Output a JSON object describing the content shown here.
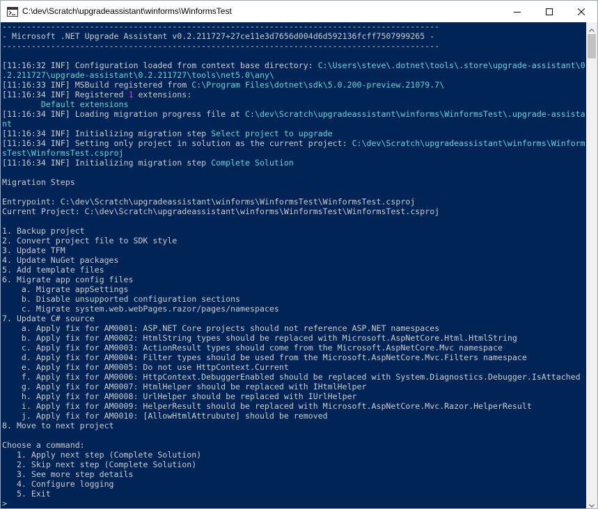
{
  "window": {
    "title": "C:\\dev\\Scratch\\upgradeassistant\\winforms\\WinformsTest",
    "controls": {
      "minimize_icon": "minimize-icon",
      "maximize_icon": "maximize-icon",
      "close_icon": "close-icon"
    }
  },
  "colors": {
    "background": "#012456",
    "text": "#cccccc",
    "highlight": "#61d6d6",
    "count": "#e03ae0"
  },
  "console": {
    "lines": [
      [
        {
          "t": "------------------------------------------------------------------------------------------",
          "c": "gray"
        }
      ],
      [
        {
          "t": "- Microsoft .NET Upgrade Assistant v0.2.211727+27ce11e3d7656d004d6d592136fcff7507999265 -",
          "c": "white"
        }
      ],
      [
        {
          "t": "------------------------------------------------------------------------------------------",
          "c": "gray"
        }
      ],
      [
        {
          "t": "",
          "c": "white"
        }
      ],
      [
        {
          "t": "[11:16:32 INF] Configuration loaded from context base directory: ",
          "c": "white"
        },
        {
          "t": "C:\\Users\\steve\\.dotnet\\tools\\.store\\upgrade-assistant\\0",
          "c": "cyan"
        }
      ],
      [
        {
          "t": ".2.211727\\upgrade-assistant\\0.2.211727\\tools\\net5.0\\any\\",
          "c": "cyan"
        }
      ],
      [
        {
          "t": "[11:16:33 INF] MSBuild registered from ",
          "c": "white"
        },
        {
          "t": "C:\\Program Files\\dotnet\\sdk\\5.0.200-preview.21079.7\\",
          "c": "cyan"
        }
      ],
      [
        {
          "t": "[11:16:34 INF] Registered ",
          "c": "white"
        },
        {
          "t": "1",
          "c": "magenta"
        },
        {
          "t": " extensions:",
          "c": "white"
        }
      ],
      [
        {
          "t": "        Default extensions",
          "c": "cyan"
        }
      ],
      [
        {
          "t": "[11:16:34 INF] Loading migration progress file at ",
          "c": "white"
        },
        {
          "t": "C:\\dev\\Scratch\\upgradeassistant\\winforms\\WinformsTest\\.upgrade-assista",
          "c": "cyan"
        }
      ],
      [
        {
          "t": "nt",
          "c": "cyan"
        }
      ],
      [
        {
          "t": "[11:16:34 INF] Initializing migration step ",
          "c": "white"
        },
        {
          "t": "Select project to upgrade",
          "c": "cyan"
        }
      ],
      [
        {
          "t": "[11:16:34 INF] Setting only project in solution as the current project: ",
          "c": "white"
        },
        {
          "t": "C:\\dev\\Scratch\\upgradeassistant\\winforms\\Winform",
          "c": "cyan"
        }
      ],
      [
        {
          "t": "sTest\\WinformsTest.csproj",
          "c": "cyan"
        }
      ],
      [
        {
          "t": "[11:16:34 INF] Initializing migration step ",
          "c": "white"
        },
        {
          "t": "Complete Solution",
          "c": "cyan"
        }
      ],
      [
        {
          "t": "",
          "c": "white"
        }
      ],
      [
        {
          "t": "Migration Steps",
          "c": "white"
        }
      ],
      [
        {
          "t": "",
          "c": "white"
        }
      ],
      [
        {
          "t": "Entrypoint: C:\\dev\\Scratch\\upgradeassistant\\winforms\\WinformsTest\\WinformsTest.csproj",
          "c": "white"
        }
      ],
      [
        {
          "t": "Current Project: C:\\dev\\Scratch\\upgradeassistant\\winforms\\WinformsTest\\WinformsTest.csproj",
          "c": "white"
        }
      ],
      [
        {
          "t": "",
          "c": "white"
        }
      ],
      [
        {
          "t": "1. Backup project",
          "c": "white"
        }
      ],
      [
        {
          "t": "2. Convert project file to SDK style",
          "c": "white"
        }
      ],
      [
        {
          "t": "3. Update TFM",
          "c": "white"
        }
      ],
      [
        {
          "t": "4. Update NuGet packages",
          "c": "white"
        }
      ],
      [
        {
          "t": "5. Add template files",
          "c": "white"
        }
      ],
      [
        {
          "t": "6. Migrate app config files",
          "c": "white"
        }
      ],
      [
        {
          "t": "    a. Migrate appSettings",
          "c": "white"
        }
      ],
      [
        {
          "t": "    b. Disable unsupported configuration sections",
          "c": "white"
        }
      ],
      [
        {
          "t": "    c. Migrate system.web.webPages.razor/pages/namespaces",
          "c": "white"
        }
      ],
      [
        {
          "t": "7. Update C# source",
          "c": "white"
        }
      ],
      [
        {
          "t": "    a. Apply fix for AM0001: ASP.NET Core projects should not reference ASP.NET namespaces",
          "c": "white"
        }
      ],
      [
        {
          "t": "    b. Apply fix for AM0002: HtmlString types should be replaced with Microsoft.AspNetCore.Html.HtmlString",
          "c": "white"
        }
      ],
      [
        {
          "t": "    c. Apply fix for AM0003: ActionResult types should come from the Microsoft.AspNetCore.Mvc namespace",
          "c": "white"
        }
      ],
      [
        {
          "t": "    d. Apply fix for AM0004: Filter types should be used from the Microsoft.AspNetCore.Mvc.Filters namespace",
          "c": "white"
        }
      ],
      [
        {
          "t": "    e. Apply fix for AM0005: Do not use HttpContext.Current",
          "c": "white"
        }
      ],
      [
        {
          "t": "    f. Apply fix for AM0006: HttpContext.DebuggerEnabled should be replaced with System.Diagnostics.Debugger.IsAttached",
          "c": "white"
        }
      ],
      [
        {
          "t": "    g. Apply fix for AM0007: HtmlHelper should be replaced with IHtmlHelper",
          "c": "white"
        }
      ],
      [
        {
          "t": "    h. Apply fix for AM0008: UrlHelper should be replaced with IUrlHelper",
          "c": "white"
        }
      ],
      [
        {
          "t": "    i. Apply fix for AM0009: HelperResult should be replaced with Microsoft.AspNetCore.Mvc.Razor.HelperResult",
          "c": "white"
        }
      ],
      [
        {
          "t": "    j. Apply fix for AM0010: [AllowHtmlAttrubute] should be removed",
          "c": "white"
        }
      ],
      [
        {
          "t": "8. Move to next project",
          "c": "white"
        }
      ],
      [
        {
          "t": "",
          "c": "white"
        }
      ],
      [
        {
          "t": "Choose a command:",
          "c": "white"
        }
      ],
      [
        {
          "t": "   1. Apply next step (Complete Solution)",
          "c": "white"
        }
      ],
      [
        {
          "t": "   2. Skip next step (Complete Solution)",
          "c": "white"
        }
      ],
      [
        {
          "t": "   3. See more step details",
          "c": "white"
        }
      ],
      [
        {
          "t": "   4. Configure logging",
          "c": "white"
        }
      ],
      [
        {
          "t": "   5. Exit",
          "c": "white"
        }
      ],
      [
        {
          "t": ">",
          "c": "white"
        }
      ]
    ]
  }
}
